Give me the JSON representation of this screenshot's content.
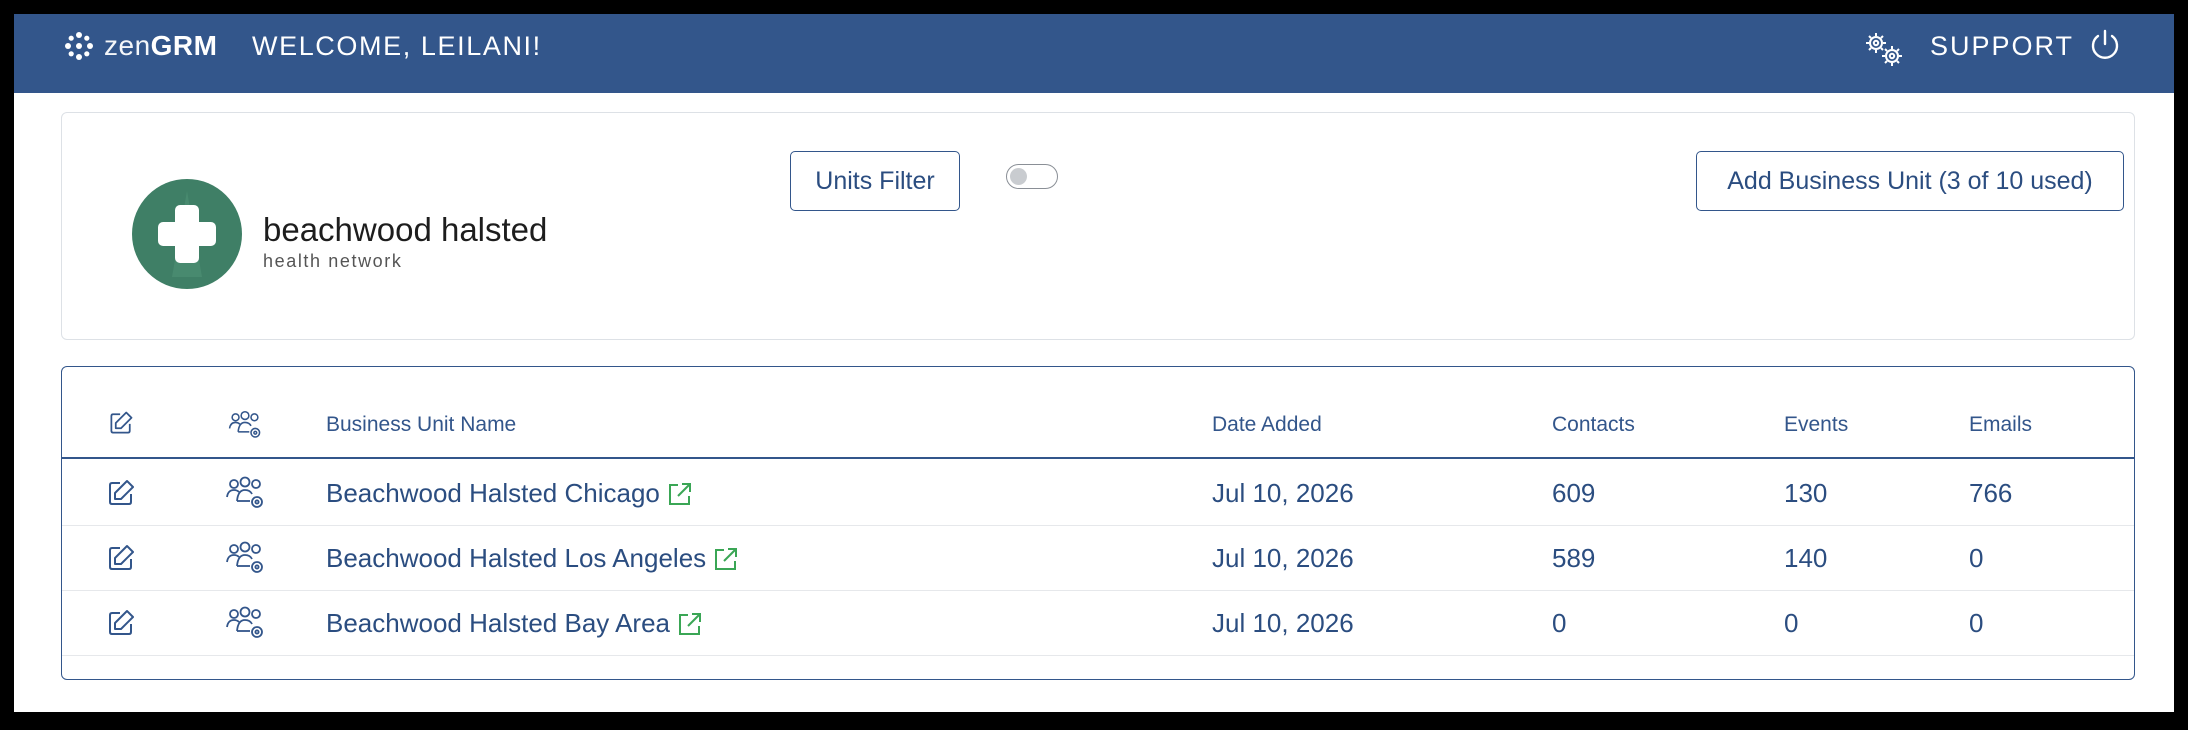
{
  "header": {
    "logo_zen": "zen",
    "logo_grm": "GRM",
    "welcome": "WELCOME, LEILANI!",
    "support": "SUPPORT",
    "color": "#33568b"
  },
  "org": {
    "name": "beachwood halsted",
    "subtitle": "health network",
    "logo_color": "#3f7f66"
  },
  "toolbar": {
    "units_filter_label": "Units Filter",
    "add_unit_label": "Add Business Unit (3 of 10 used)",
    "toggle_on": false
  },
  "table": {
    "columns": [
      "Business Unit Name",
      "Date Added",
      "Contacts",
      "Events",
      "Emails"
    ],
    "rows": [
      {
        "name": "Beachwood Halsted Chicago",
        "date": "Jul 10, 2026",
        "contacts": "609",
        "events": "130",
        "emails": "766"
      },
      {
        "name": "Beachwood Halsted Los Angeles",
        "date": "Jul 10, 2026",
        "contacts": "589",
        "events": "140",
        "emails": "0"
      },
      {
        "name": "Beachwood Halsted Bay Area",
        "date": "Jul 10, 2026",
        "contacts": "0",
        "events": "0",
        "emails": "0"
      }
    ]
  }
}
